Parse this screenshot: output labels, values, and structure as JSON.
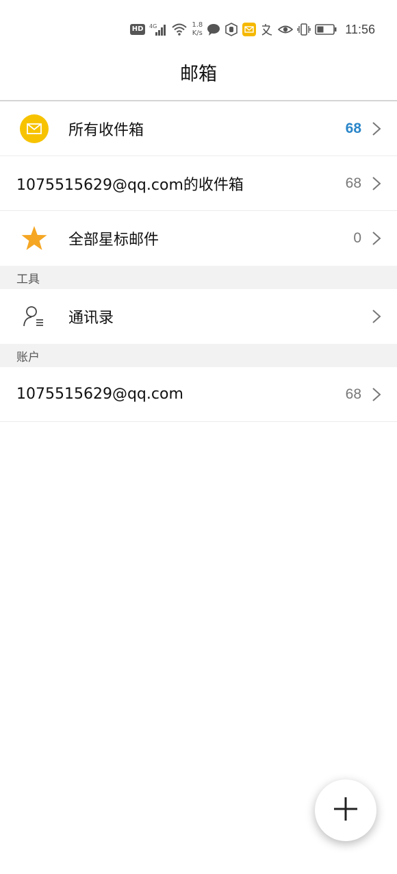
{
  "status_bar": {
    "hd_label": "HD",
    "network_label": "4G",
    "speed_value": "1.8",
    "speed_unit": "K/s",
    "time": "11:56",
    "icons": [
      "hd-icon",
      "signal-icon",
      "wifi-icon",
      "chat-bubble-icon",
      "hand-icon",
      "mail-app-icon",
      "translate-icon",
      "eye-icon",
      "vibrate-icon",
      "battery-icon"
    ]
  },
  "header": {
    "title": "邮箱"
  },
  "mailboxes": [
    {
      "icon": "envelope-icon",
      "label": "所有收件箱",
      "count": "68",
      "accent_color": "#2a86c9"
    },
    {
      "icon": "",
      "label": "1075515629@qq.com的收件箱",
      "count": "68"
    },
    {
      "icon": "star-icon",
      "label": "全部星标邮件",
      "count": "0"
    }
  ],
  "sections": {
    "tools": {
      "title": "工具",
      "items": [
        {
          "icon": "contacts-icon",
          "label": "通讯录"
        }
      ]
    },
    "accounts": {
      "title": "账户",
      "items": [
        {
          "label": "1075515629@qq.com",
          "count": "68"
        }
      ]
    }
  },
  "fab": {
    "icon": "plus-icon"
  },
  "colors": {
    "accent": "#2a86c9",
    "envelope_bg": "#f7c300",
    "star": "#f5a623",
    "section_bg": "#f2f2f2"
  }
}
